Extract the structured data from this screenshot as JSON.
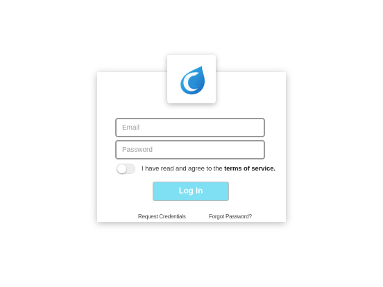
{
  "brand": {
    "logo_icon": "water-drop-logo-icon",
    "colors": {
      "light_blue": "#35b8ea",
      "dark_blue": "#1a6bc2",
      "swirl": "#ffffff"
    }
  },
  "form": {
    "email_placeholder": "Email",
    "email_value": "",
    "password_placeholder": "Password",
    "password_value": "",
    "terms_toggle": {
      "checked": false
    },
    "terms_prefix": "I have read and agree to the ",
    "terms_link": "terms of service.",
    "login_label": "Log In",
    "login_color": "#7fdff3"
  },
  "links": {
    "request_credentials": "Request Credentials",
    "forgot_password": "Forgot Password?"
  }
}
